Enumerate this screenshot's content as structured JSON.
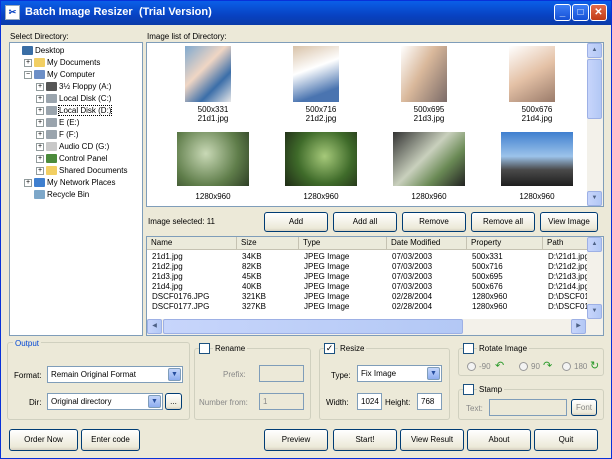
{
  "window": {
    "title": "Batch Image Resizer",
    "edition": "(Trial Version)",
    "buttons": {
      "minimize": "_",
      "maximize": "□",
      "close": "✕"
    }
  },
  "directory": {
    "label": "Select Directory:",
    "tree": [
      {
        "label": "Desktop",
        "icon": "desktop-icon",
        "level": 0,
        "expander": ""
      },
      {
        "label": "My Documents",
        "icon": "folder-icon",
        "level": 1,
        "expander": "+"
      },
      {
        "label": "My Computer",
        "icon": "computer-icon",
        "level": 1,
        "expander": "−"
      },
      {
        "label": "3½ Floppy (A:)",
        "icon": "floppy-icon",
        "level": 2,
        "expander": "+"
      },
      {
        "label": "Local Disk (C:)",
        "icon": "drive-icon",
        "level": 2,
        "expander": "+"
      },
      {
        "label": "Local Disk (D:)",
        "icon": "drive-icon",
        "level": 2,
        "expander": "+",
        "selected": true
      },
      {
        "label": "E (E:)",
        "icon": "drive-icon",
        "level": 2,
        "expander": "+"
      },
      {
        "label": "F (F:)",
        "icon": "drive-icon",
        "level": 2,
        "expander": "+"
      },
      {
        "label": "Audio CD (G:)",
        "icon": "cd-icon",
        "level": 2,
        "expander": "+"
      },
      {
        "label": "Control Panel",
        "icon": "control-panel-icon",
        "level": 2,
        "expander": "+"
      },
      {
        "label": "Shared Documents",
        "icon": "folder-icon",
        "level": 2,
        "expander": "+"
      },
      {
        "label": "My Network Places",
        "icon": "network-icon",
        "level": 1,
        "expander": "+"
      },
      {
        "label": "Recycle Bin",
        "icon": "recycle-bin-icon",
        "level": 1,
        "expander": ""
      }
    ]
  },
  "images": {
    "label": "Image list of Directory:",
    "thumbnails": [
      {
        "size": "500x331",
        "name": "21d1.jpg"
      },
      {
        "size": "500x716",
        "name": "21d2.jpg"
      },
      {
        "size": "500x695",
        "name": "21d3.jpg"
      },
      {
        "size": "500x676",
        "name": "21d4.jpg"
      },
      {
        "size": "1280x960",
        "name": ""
      },
      {
        "size": "1280x960",
        "name": ""
      },
      {
        "size": "1280x960",
        "name": ""
      },
      {
        "size": "1280x960",
        "name": ""
      }
    ],
    "selected_label": "Image selected: 11",
    "buttons": {
      "add": "Add",
      "add_all": "Add all",
      "remove": "Remove",
      "remove_all": "Remove all",
      "view": "View Image"
    }
  },
  "list": {
    "columns": [
      "Name",
      "Size",
      "Type",
      "Date Modified",
      "Property",
      "Path"
    ],
    "rows": [
      [
        "21d1.jpg",
        "34KB",
        "JPEG Image",
        "07/03/2003",
        "500x331",
        "D:\\21d1.jpg"
      ],
      [
        "21d2.jpg",
        "82KB",
        "JPEG Image",
        "07/03/2003",
        "500x716",
        "D:\\21d2.jpg"
      ],
      [
        "21d3.jpg",
        "45KB",
        "JPEG Image",
        "07/03/2003",
        "500x695",
        "D:\\21d3.jpg"
      ],
      [
        "21d4.jpg",
        "40KB",
        "JPEG Image",
        "07/03/2003",
        "500x676",
        "D:\\21d4.jpg"
      ],
      [
        "DSCF0176.JPG",
        "321KB",
        "JPEG Image",
        "02/28/2004",
        "1280x960",
        "D:\\DSCF01"
      ],
      [
        "DSCF0177.JPG",
        "327KB",
        "JPEG Image",
        "02/28/2004",
        "1280x960",
        "D:\\DSCF01"
      ]
    ]
  },
  "output": {
    "title": "Output",
    "format_label": "Format:",
    "format_value": "Remain Original Format",
    "dir_label": "Dir:",
    "dir_value": "Original directory",
    "browse": "..."
  },
  "rename": {
    "label": "Rename",
    "prefix_label": "Prefix:",
    "prefix_value": "",
    "number_label": "Number from:",
    "number_value": "1"
  },
  "resize": {
    "label": "Resize",
    "type_label": "Type:",
    "type_value": "Fix Image",
    "width_label": "Width:",
    "width_value": "1024",
    "height_label": "Height:",
    "height_value": "768"
  },
  "rotate": {
    "label": "Rotate Image",
    "options": [
      "-90",
      "90",
      "180"
    ]
  },
  "stamp": {
    "label": "Stamp",
    "text_label": "Text:",
    "text_value": "",
    "font_button": "Font"
  },
  "footer": {
    "order": "Order Now",
    "enter_code": "Enter code",
    "preview": "Preview",
    "start": "Start!",
    "view_result": "View Result",
    "about": "About",
    "quit": "Quit"
  }
}
